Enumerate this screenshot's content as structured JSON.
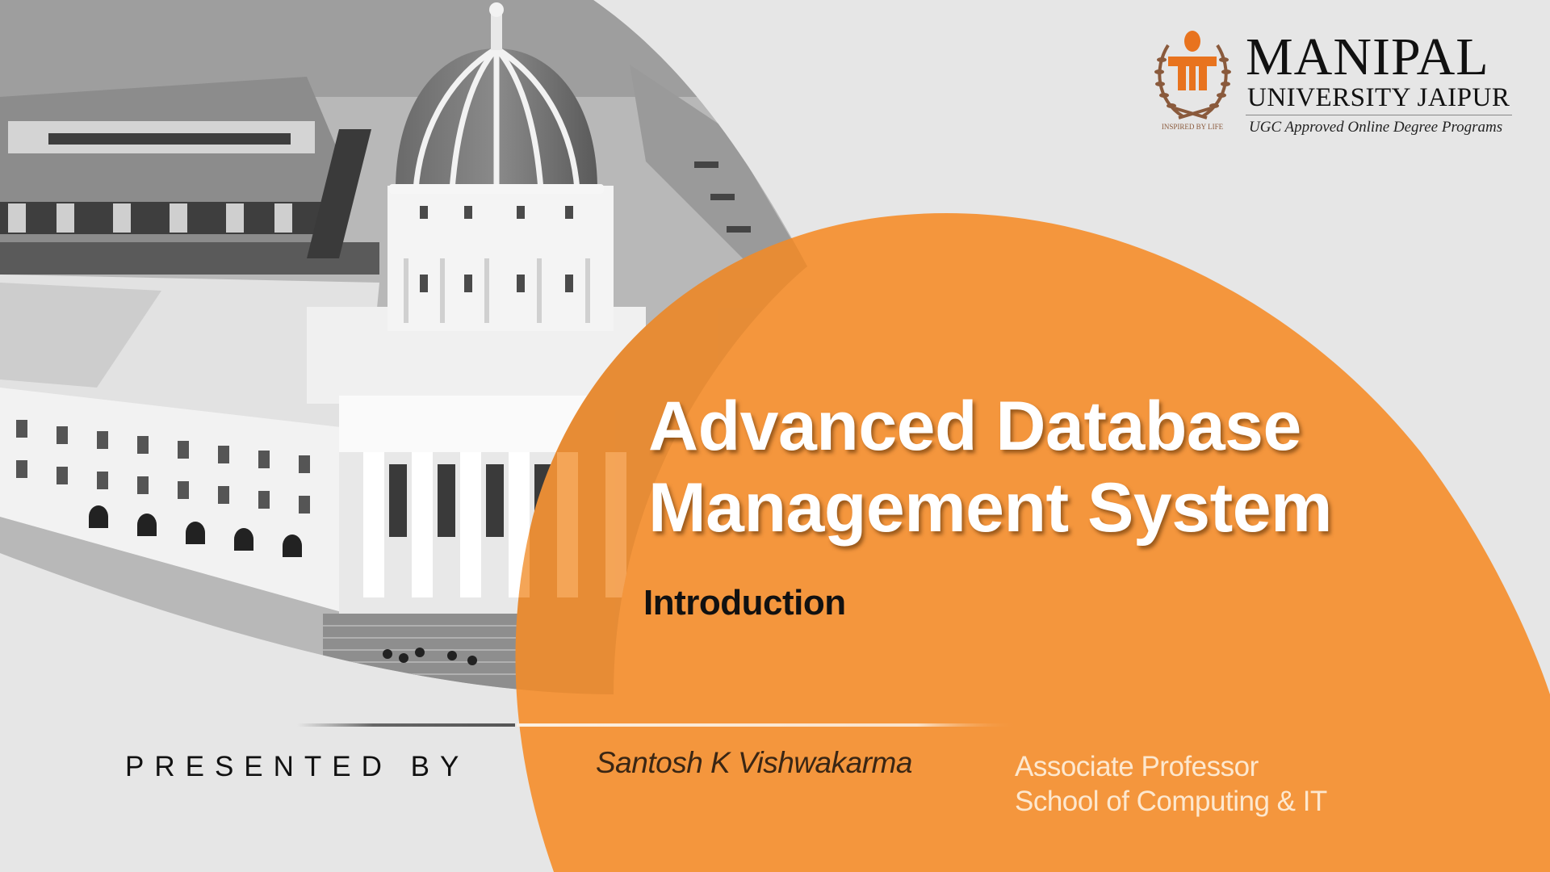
{
  "slide": {
    "colors": {
      "background": "#e6e6e6",
      "accent_orange": "#f4963d",
      "title_text": "#ffffff",
      "name_text": "#3a2614",
      "role_text": "#fde8cf"
    },
    "logo": {
      "emblem_icon": "manipal-emblem-icon",
      "emblem_motto": "INSPIRED BY LIFE",
      "wordmark_line1": "MANIPAL",
      "wordmark_line2": "UNIVERSITY JAIPUR",
      "tagline": "UGC Approved Online Degree Programs"
    },
    "title": {
      "line1": "Advanced Database",
      "line2": "Management System"
    },
    "subtitle": "Introduction",
    "presenter": {
      "label": "PRESENTED BY",
      "name": "Santosh K Vishwakarma",
      "designation": "Associate Professor",
      "department": "School of Computing & IT"
    },
    "background_image": "campus-building-photo"
  }
}
